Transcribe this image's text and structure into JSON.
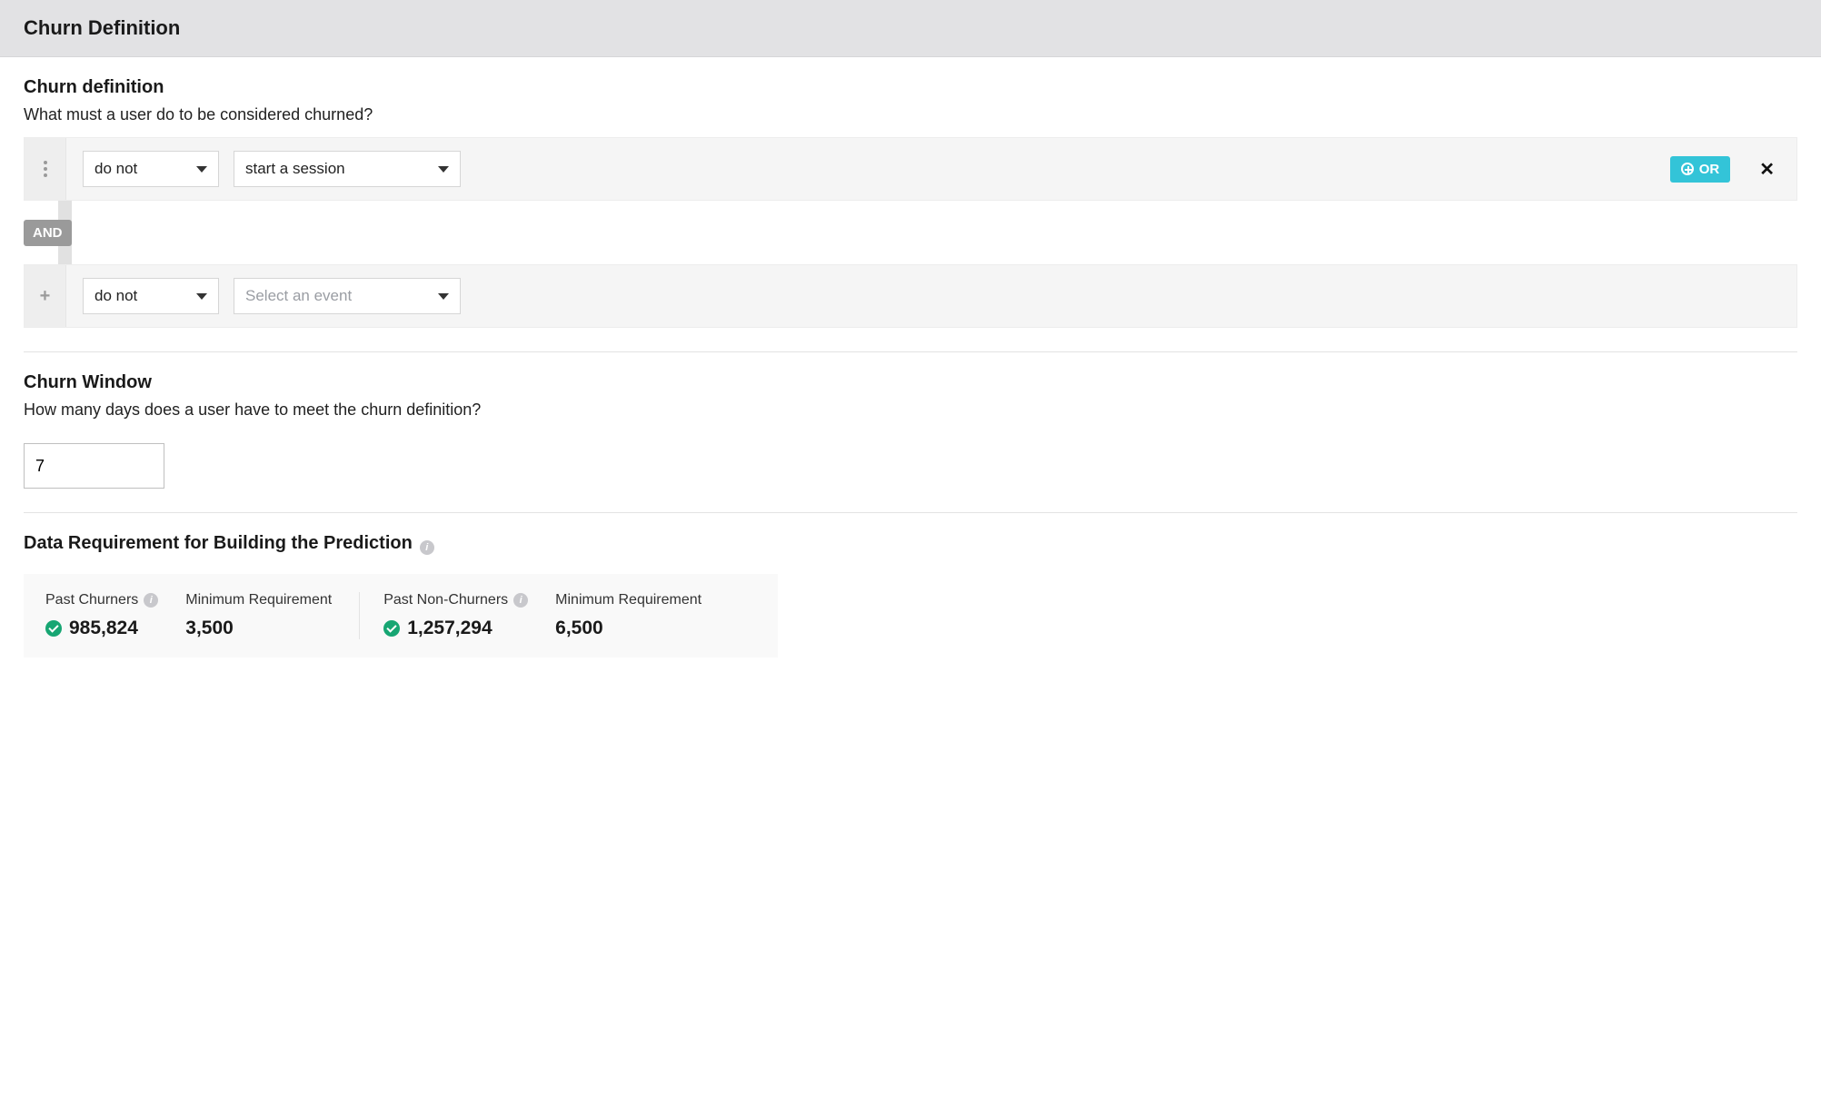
{
  "header": {
    "title": "Churn Definition"
  },
  "churnDef": {
    "title": "Churn definition",
    "subtitle": "What must a user do to be considered churned?",
    "rows": [
      {
        "condition": "do not",
        "event": "start a session",
        "eventPlaceholder": "",
        "showOr": true
      },
      {
        "condition": "do not",
        "event": "",
        "eventPlaceholder": "Select an event",
        "showOr": false
      }
    ],
    "connector": "AND",
    "orLabel": "OR"
  },
  "churnWindow": {
    "title": "Churn Window",
    "subtitle": "How many days does a user have to meet the churn definition?",
    "value": "7"
  },
  "dataReq": {
    "title": "Data Requirement for Building the Prediction",
    "pastChurners": {
      "label": "Past Churners",
      "value": "985,824"
    },
    "minReqChurners": {
      "label": "Minimum Requirement",
      "value": "3,500"
    },
    "pastNonChurners": {
      "label": "Past Non-Churners",
      "value": "1,257,294"
    },
    "minReqNonChurners": {
      "label": "Minimum Requirement",
      "value": "6,500"
    }
  }
}
